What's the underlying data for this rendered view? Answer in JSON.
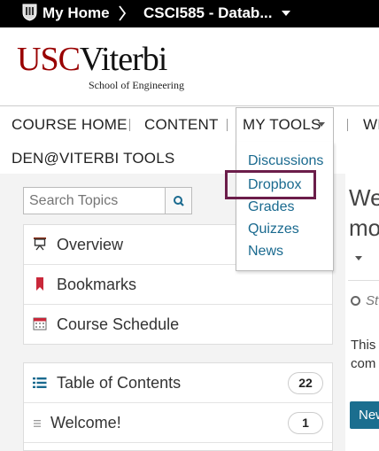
{
  "topbar": {
    "home_label": "My Home",
    "course_label": "CSCI585 - Datab..."
  },
  "logo": {
    "usc": "USC",
    "viterbi": "Viterbi",
    "school": "School of Engineering"
  },
  "nav": {
    "course_home": "COURSE HOME",
    "content": "CONTENT",
    "my_tools": "MY TOOLS",
    "cut_item": "WI",
    "den_tools": "DEN@VITERBI TOOLS"
  },
  "dropdown": {
    "items": [
      "Discussions",
      "Dropbox",
      "Grades",
      "Quizzes",
      "News"
    ]
  },
  "search": {
    "placeholder": "Search Topics"
  },
  "menu": {
    "items": [
      "Overview",
      "Bookmarks",
      "Course Schedule"
    ]
  },
  "toc": {
    "label": "Table of Contents",
    "count": "22",
    "welcome_label": "Welcome!",
    "welcome_count": "1"
  },
  "main": {
    "title_line1": "We",
    "title_line2": "mo",
    "status_text": "St",
    "body_line1": "This",
    "body_line2": "com",
    "new_button": "New"
  },
  "colors": {
    "usc_red": "#990000",
    "link_blue": "#1a6a8f",
    "highlight_border": "#6b1d4a",
    "button_teal": "#1b6e8f"
  }
}
